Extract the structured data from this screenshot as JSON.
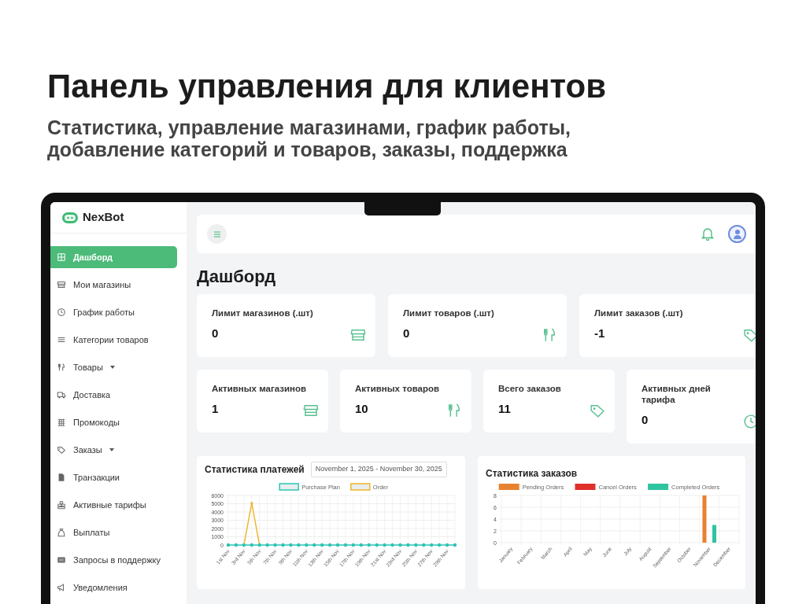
{
  "promo": {
    "headline": "Панель управления для клиентов",
    "subheadline_lines": [
      "Статистика, управление магазинами, график работы,",
      "добавление категорий и товаров, заказы, поддержка"
    ]
  },
  "app": {
    "brand": "NexBot",
    "sidebar": {
      "items": [
        {
          "label": "Дашборд",
          "selected": true,
          "dropdown": false
        },
        {
          "label": "Мои магазины",
          "selected": false,
          "dropdown": false
        },
        {
          "label": "График работы",
          "selected": false,
          "dropdown": false
        },
        {
          "label": "Категории товаров",
          "selected": false,
          "dropdown": false
        },
        {
          "label": "Товары",
          "selected": false,
          "dropdown": true
        },
        {
          "label": "Доставка",
          "selected": false,
          "dropdown": false
        },
        {
          "label": "Промокоды",
          "selected": false,
          "dropdown": false
        },
        {
          "label": "Заказы",
          "selected": false,
          "dropdown": true
        },
        {
          "label": "Транзакции",
          "selected": false,
          "dropdown": false
        },
        {
          "label": "Активные тарифы",
          "selected": false,
          "dropdown": false
        },
        {
          "label": "Выплаты",
          "selected": false,
          "dropdown": false
        },
        {
          "label": "Запросы в поддержку",
          "selected": false,
          "dropdown": false
        },
        {
          "label": "Уведомления",
          "selected": false,
          "dropdown": false
        }
      ]
    },
    "page_title": "Дашборд",
    "limit_cards": [
      {
        "label": "Лимит магазинов (.шт)",
        "value": "0"
      },
      {
        "label": "Лимит товаров (.шт)",
        "value": "0"
      },
      {
        "label": "Лимит заказов (.шт)",
        "value": "-1"
      }
    ],
    "stat_cards": [
      {
        "label": "Активных магазинов",
        "value": "1"
      },
      {
        "label": "Активных товаров",
        "value": "10"
      },
      {
        "label": "Всего заказов",
        "value": "11"
      },
      {
        "label": "Активных дней тарифа",
        "value": "0"
      }
    ],
    "payments_chart": {
      "title": "Статистика платежей",
      "date_range": "November 1, 2025 - November 30, 2025",
      "chart_data": {
        "type": "line",
        "grid": true,
        "legend": true,
        "categories": [
          "1st Nov",
          null,
          "3rd Nov",
          null,
          "5th Nov",
          null,
          "7th Nov",
          null,
          "9th Nov",
          null,
          "11th Nov",
          null,
          "13th Nov",
          null,
          "15th Nov",
          null,
          "17th Nov",
          null,
          "19th Nov",
          null,
          "21st Nov",
          null,
          "23rd Nov",
          null,
          "25th Nov",
          null,
          "27th Nov",
          null,
          "29th Nov",
          null
        ],
        "series": [
          {
            "name": "Purchase Plan",
            "color": "#2ec4b6",
            "values": [
              0,
              0,
              0,
              0,
              0,
              0,
              0,
              0,
              0,
              0,
              0,
              0,
              0,
              0,
              0,
              0,
              0,
              0,
              0,
              0,
              0,
              0,
              0,
              0,
              0,
              0,
              0,
              0,
              0,
              0
            ]
          },
          {
            "name": "Order",
            "color": "#f0b429",
            "values": [
              null,
              null,
              0,
              5100,
              0,
              null,
              null,
              null,
              null,
              null,
              null,
              null,
              null,
              null,
              null,
              null,
              null,
              null,
              null,
              null,
              null,
              null,
              null,
              null,
              null,
              null,
              null,
              null,
              null,
              null
            ]
          }
        ],
        "ylim": [
          0,
          6000
        ],
        "yticks": [
          {
            "value": 0,
            "label": "0"
          },
          1000,
          2000,
          3000,
          4000,
          5000,
          6000
        ]
      }
    },
    "orders_chart": {
      "title": "Статистика заказов",
      "chart_data": {
        "type": "bar",
        "grid": true,
        "legend": true,
        "categories": [
          "January",
          "February",
          "March",
          "April",
          "May",
          "June",
          "July",
          "August",
          "September",
          "October",
          "November",
          "December"
        ],
        "series": [
          {
            "name": "Pending Orders",
            "color": "#e8822f",
            "values": [
              0,
              0,
              0,
              0,
              0,
              0,
              0,
              0,
              0,
              0,
              8,
              0
            ]
          },
          {
            "name": "Cancel Orders",
            "color": "#e0302a",
            "values": [
              0,
              0,
              0,
              0,
              0,
              0,
              0,
              0,
              0,
              0,
              0,
              0
            ]
          },
          {
            "name": "Completed Orders",
            "color": "#2ec4a0",
            "values": [
              0,
              0,
              0,
              0,
              0,
              0,
              0,
              0,
              0,
              0,
              3,
              0
            ]
          }
        ],
        "ylim": [
          0,
          8
        ],
        "yticks": [
          {
            "value": 0,
            "label": "0"
          },
          2,
          4,
          6,
          8
        ]
      }
    }
  }
}
